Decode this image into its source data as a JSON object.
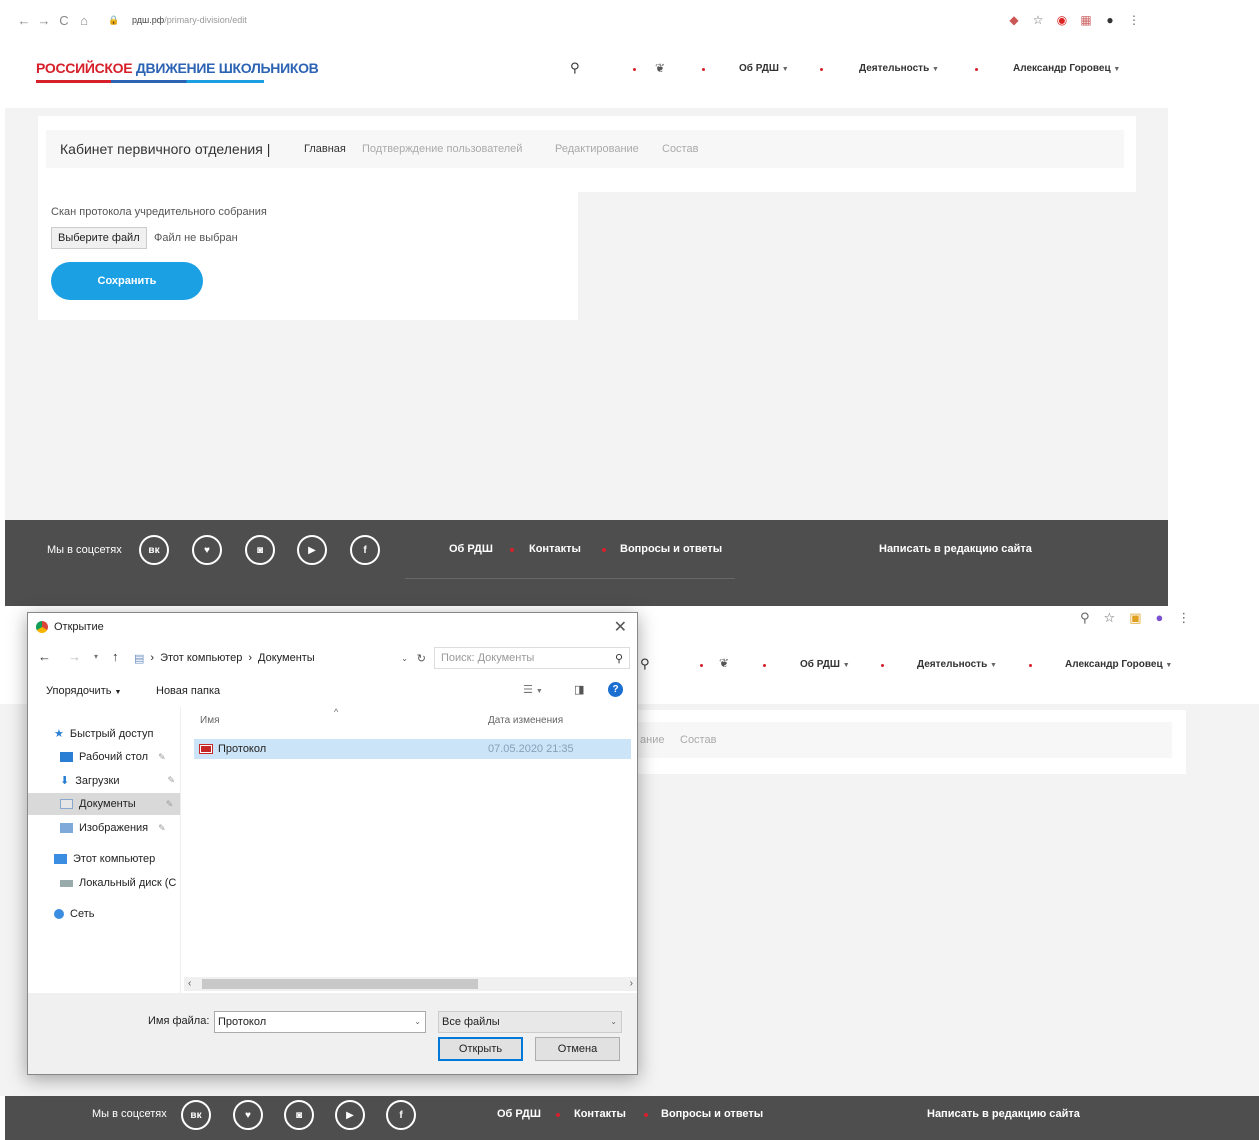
{
  "browser": {
    "url_host": "рдш.рф",
    "url_path": "/primary-division/edit"
  },
  "site": {
    "logo_red": "РОССИЙСКОЕ",
    "logo_blue_1": "ДВИЖЕНИЕ",
    "logo_blue_2": "ШКОЛЬНИКОВ",
    "nav": {
      "about": "Об РДШ",
      "activity": "Деятельность",
      "user": "Александр Горовец"
    }
  },
  "cabinet": {
    "title": "Кабинет первичного отделения |",
    "tabs": [
      "Главная",
      "Подтверждение пользователей",
      "Редактирование",
      "Состав"
    ],
    "partial_tabs": [
      "ание",
      "Состав"
    ]
  },
  "form": {
    "label": "Скан протокола учредительного собрания",
    "file_button": "Выберите файл",
    "file_status": "Файл не выбран",
    "save": "Сохранить"
  },
  "footer": {
    "social_label": "Мы в соцсетях",
    "social": [
      "vk",
      "twitter",
      "instagram",
      "youtube",
      "facebook"
    ],
    "social_glyphs": [
      "вк",
      "♥",
      "◙",
      "▶",
      "f"
    ],
    "links": [
      "Об РДШ",
      "Контакты",
      "Вопросы и ответы"
    ],
    "write": "Написать в редакцию сайта"
  },
  "dialog": {
    "title": "Открытие",
    "path": [
      "Этот компьютер",
      "Документы"
    ],
    "search_placeholder": "Поиск: Документы",
    "organize": "Упорядочить",
    "new_folder": "Новая папка",
    "sidebar": [
      {
        "label": "Быстрый доступ",
        "icon": "star-icon",
        "pinned": false
      },
      {
        "label": "Рабочий стол",
        "icon": "desktop-icon",
        "pinned": true
      },
      {
        "label": "Загрузки",
        "icon": "download-icon",
        "pinned": true
      },
      {
        "label": "Документы",
        "icon": "documents-icon",
        "pinned": true
      },
      {
        "label": "Изображения",
        "icon": "pictures-icon",
        "pinned": true
      },
      {
        "label": "Этот компьютер",
        "icon": "computer-icon",
        "pinned": false
      },
      {
        "label": "Локальный диск (C",
        "icon": "disk-icon",
        "pinned": false
      },
      {
        "label": "Сеть",
        "icon": "network-icon",
        "pinned": false
      }
    ],
    "columns": {
      "name": "Имя",
      "date": "Дата изменения"
    },
    "files": [
      {
        "name": "Протокол",
        "date": "07.05.2020 21:35"
      }
    ],
    "filename_label": "Имя файла:",
    "filename_value": "Протокол",
    "filter": "Все файлы",
    "open": "Открыть",
    "cancel": "Отмена"
  },
  "colors": {
    "accent": "#1ca0e4",
    "brand_red": "#d6202a",
    "brand_blue": "#2c63b3",
    "footer_bg": "#4e4e4e"
  }
}
